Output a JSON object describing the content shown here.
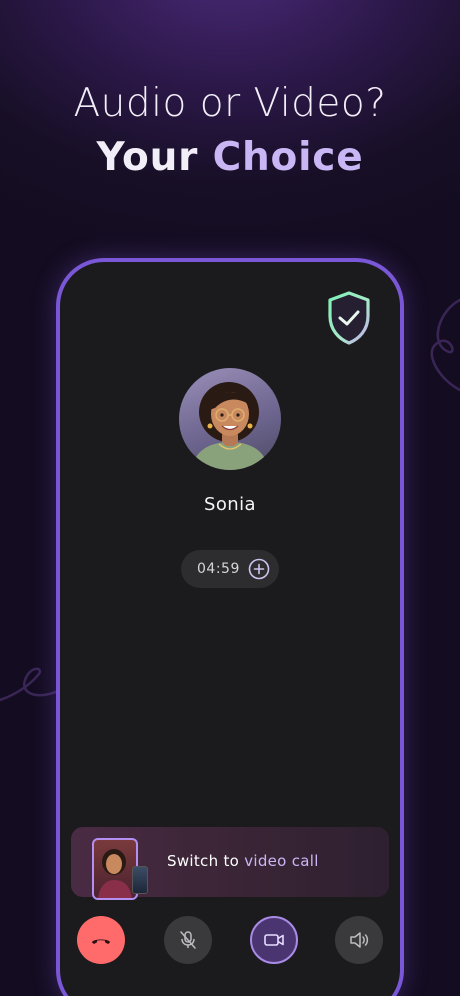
{
  "headline": {
    "line1": "Audio or Video?",
    "line2_word1": "Your",
    "line2_word2": "Choice"
  },
  "call": {
    "caller_name": "Sonia",
    "timer": "04:59"
  },
  "switch_card": {
    "label_prefix": "Switch to ",
    "label_accent": "video call"
  },
  "controls": [
    {
      "name": "end-call",
      "icon": "phone-hangup-icon",
      "color": "#ff6b6b"
    },
    {
      "name": "mute",
      "icon": "mic-off-icon",
      "color": "#3a3a3d"
    },
    {
      "name": "video",
      "icon": "video-camera-icon",
      "color": "#4b3570"
    },
    {
      "name": "speaker",
      "icon": "speaker-icon",
      "color": "#3a3a3d"
    }
  ],
  "colors": {
    "accent": "#c9b6f5",
    "frame": "#7a57d6",
    "shield": "#6fe0b0",
    "hangup": "#ff6b6b"
  }
}
